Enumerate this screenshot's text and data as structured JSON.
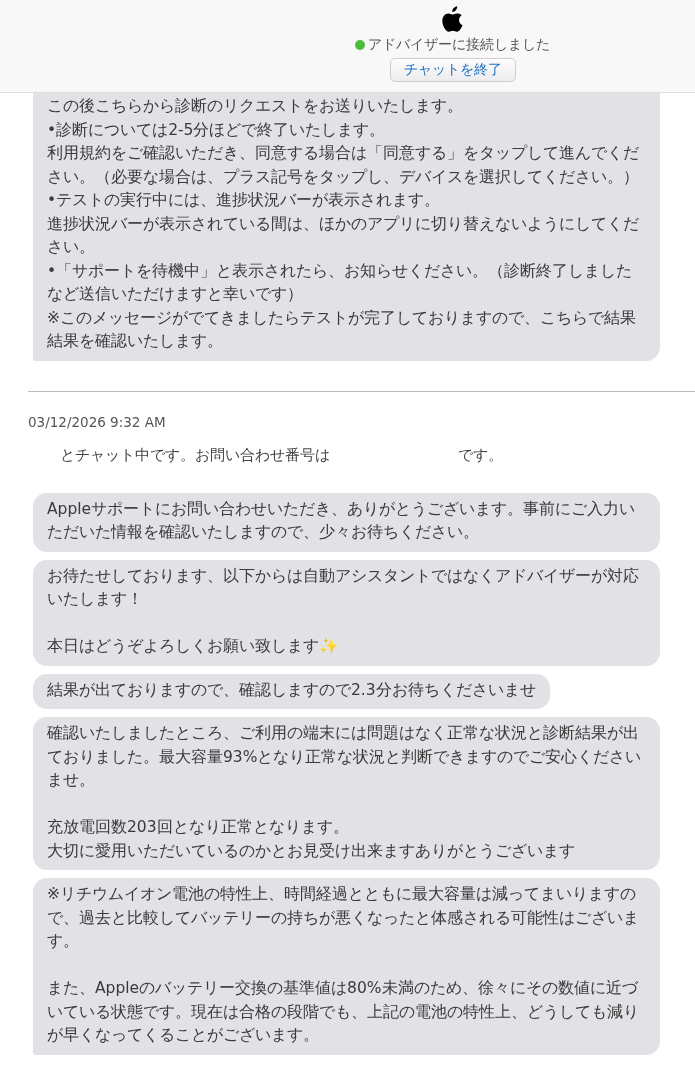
{
  "header": {
    "status": {
      "text": "アドバイザーに接続しました",
      "connected": true
    },
    "end_button": "チャットを終了"
  },
  "earlier_messages": [
    {
      "paragraphs": [
        [
          "この後こちらから診断のリクエストをお送りいたします。",
          "•診断については2-5分ほどで終了いたします。",
          "利用規約をご確認いただき、同意する場合は「同意する」をタップして進んでください。（必要な場合は、プラス記号をタップし、デバイスを選択してください。）",
          "•テストの実行中には、進捗状況バーが表示されます。",
          "進捗状況バーが表示されている間は、ほかのアプリに切り替えないようにしてください。",
          "•「サポートを待機中」と表示されたら、お知らせください。（診断終了しましたなど送信いただけますと幸いです）",
          "※このメッセージがでてきましたらテストが完了しておりますので、こちらで結果結果を確認いたします。"
        ]
      ]
    }
  ],
  "timestamp": "03/12/2026 9:32 AM",
  "system_line": {
    "before": "とチャット中です。お問い合わせ番号は",
    "after": "です。"
  },
  "messages": [
    {
      "paragraphs": [
        [
          "Appleサポートにお問い合わせいただき、ありがとうございます。事前にご入力いただいた情報を確認いたしますので、少々お待ちください。"
        ]
      ]
    },
    {
      "paragraphs": [
        [
          "お待たせしております、以下からは自動アシスタントではなくアドバイザーが対応いたします！"
        ],
        [
          "本日はどうぞよろしくお願い致します✨"
        ]
      ]
    },
    {
      "paragraphs": [
        [
          "結果が出ておりますので、確認しますので2.3分お待ちくださいませ"
        ]
      ]
    },
    {
      "paragraphs": [
        [
          "確認いたしましたところ、ご利用の端末には問題はなく正常な状況と診断結果が出ておりました。最大容量93%となり正常な状況と判断できますのでご安心くださいませ。"
        ],
        [
          "充放電回数203回となり正常となります。",
          "大切に愛用いただいているのかとお見受け出来ますありがとうございます"
        ]
      ]
    },
    {
      "paragraphs": [
        [
          "※リチウムイオン電池の特性上、時間経過とともに最大容量は減ってまいりますので、過去と比較してバッテリーの持ちが悪くなったと体感される可能性はございます。"
        ],
        [
          "また、Appleのバッテリー交換の基準値は80%未満のため、徐々にその数値に近づいている状態です。現在は合格の段階でも、上記の電池の特性上、どうしても減りが早くなってくることがございます。"
        ]
      ]
    }
  ]
}
